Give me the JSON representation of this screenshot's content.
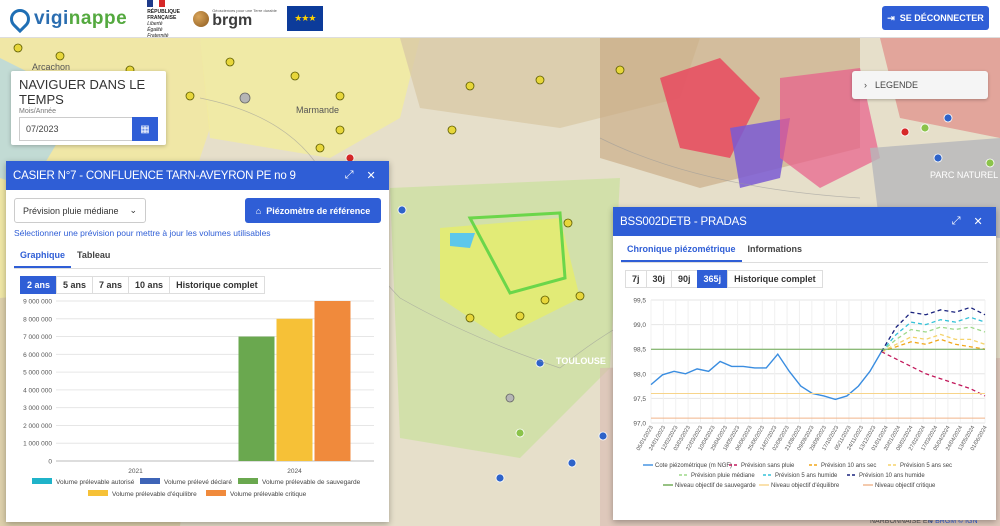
{
  "header": {
    "brand_part1": "vigi",
    "brand_part2": "nappe",
    "republique_lines": [
      "RÉPUBLIQUE",
      "FRANÇAISE",
      "Liberté",
      "Égalité",
      "Fraternité"
    ],
    "brgm_tagline": "Géosciences pour une Terre durable",
    "brgm_name": "brgm",
    "eu_flag": "eu-flag-icon",
    "logout_label": "SE DÉCONNECTER"
  },
  "map": {
    "labels": [
      "Arcachon",
      "Marmande",
      "TOULOUSE",
      "PARC NATUREL",
      "NARBONNAISE EN",
      "© BRGM © IGN"
    ]
  },
  "time_navigator": {
    "title": "NAVIGUER DANS LE TEMPS",
    "sublabel": "Mois/Année",
    "value": "07/2023"
  },
  "legend_button": {
    "label": "LEGENDE"
  },
  "left_panel": {
    "title": "CASIER N°7 - CONFLUENCE TARN-AVEYRON PE no 9",
    "select_value": "Prévision pluie médiane",
    "ref_button": "Piézomètre de référence",
    "hint": "Sélectionner une prévision pour mettre à jour les volumes utilisables",
    "tabs": [
      "Graphique",
      "Tableau"
    ],
    "periods": [
      "2 ans",
      "5 ans",
      "7 ans",
      "10 ans",
      "Historique complet"
    ]
  },
  "right_panel": {
    "title": "BSS002DETB - PRADAS",
    "tabs": [
      "Chronique piézométrique",
      "Informations"
    ],
    "periods": [
      "7j",
      "30j",
      "90j",
      "365j",
      "Historique complet"
    ]
  },
  "chart_data": [
    {
      "type": "bar",
      "categories": [
        "2021",
        "2024"
      ],
      "ylim": [
        0,
        9000000
      ],
      "yticks": [
        "0",
        "1 000 000",
        "2 000 000",
        "3 000 000",
        "4 000 000",
        "5 000 000",
        "6 000 000",
        "7 000 000",
        "8 000 000",
        "9 000 000"
      ],
      "series": [
        {
          "name": "Volume prélevable autorisé",
          "color": "#1fb3c9",
          "values": [
            0,
            0
          ]
        },
        {
          "name": "Volume prélevé déclaré",
          "color": "#3e64b7",
          "values": [
            0,
            0
          ]
        },
        {
          "name": "Volume prélevable de sauvegarde",
          "color": "#6aa84f",
          "values": [
            0,
            7000000
          ]
        },
        {
          "name": "Volume prélevable d'équilibre",
          "color": "#f6c137",
          "values": [
            0,
            8000000
          ]
        },
        {
          "name": "Volume prélevable critique",
          "color": "#f08a3c",
          "values": [
            0,
            9000000
          ]
        }
      ]
    },
    {
      "type": "line",
      "ylim": [
        97.0,
        99.5
      ],
      "yticks": [
        "97,0",
        "97,5",
        "98,0",
        "98,5",
        "99,0",
        "99,5"
      ],
      "x": [
        "05/01/2023",
        "24/01/2023",
        "12/02/2023",
        "03/03/2023",
        "22/03/2023",
        "10/04/2023",
        "29/04/2023",
        "18/05/2023",
        "06/06/2023",
        "25/06/2023",
        "14/07/2023",
        "02/08/2023",
        "21/08/2023",
        "09/09/2023",
        "28/09/2023",
        "17/10/2023",
        "05/11/2023",
        "24/11/2023",
        "13/12/2023",
        "01/01/2024",
        "20/01/2024",
        "08/02/2024",
        "27/02/2024",
        "17/03/2024",
        "05/04/2024",
        "24/04/2024",
        "13/05/2024",
        "01/06/2024"
      ],
      "series": [
        {
          "name": "Cote piézométrique (m NGF)",
          "color": "#3a8de0",
          "values": [
            97.78,
            97.98,
            98.05,
            98.0,
            98.1,
            98.05,
            98.25,
            98.15,
            98.15,
            98.12,
            98.12,
            98.4,
            98.05,
            97.75,
            97.6,
            97.55,
            97.48,
            97.55,
            97.75,
            98.05,
            98.45
          ]
        },
        {
          "name": "Prévision sans pluie",
          "color": "#c2185b",
          "values": [
            98.45,
            98.3,
            98.15,
            98.0,
            97.9,
            97.8,
            97.7,
            97.55
          ]
        },
        {
          "name": "Prévision 10 ans sec",
          "color": "#f2a71b",
          "values": [
            98.45,
            98.55,
            98.65,
            98.6,
            98.7,
            98.6,
            98.55,
            98.5
          ]
        },
        {
          "name": "Prévision 5 ans sec",
          "color": "#f5d36b",
          "values": [
            98.45,
            98.6,
            98.75,
            98.7,
            98.8,
            98.7,
            98.7,
            98.6
          ]
        },
        {
          "name": "Prévision pluie médiane",
          "color": "#9ed88a",
          "values": [
            98.45,
            98.7,
            98.9,
            98.85,
            98.95,
            98.9,
            98.95,
            98.85
          ]
        },
        {
          "name": "Prévision 5 ans humide",
          "color": "#35c2d8",
          "values": [
            98.45,
            98.8,
            99.05,
            99.0,
            99.1,
            99.05,
            99.15,
            99.05
          ]
        },
        {
          "name": "Prévision 10 ans humide",
          "color": "#1a237e",
          "values": [
            98.45,
            98.95,
            99.25,
            99.2,
            99.3,
            99.25,
            99.35,
            99.2
          ]
        },
        {
          "name": "Niveau objectif de sauvegarde",
          "color": "#6aa84f",
          "values": [
            98.5
          ]
        },
        {
          "name": "Niveau objectif d'équilibre",
          "color": "#f7d48a",
          "values": [
            97.6
          ]
        },
        {
          "name": "Niveau objectif critique",
          "color": "#f0b48a",
          "values": [
            97.1
          ]
        }
      ]
    }
  ]
}
